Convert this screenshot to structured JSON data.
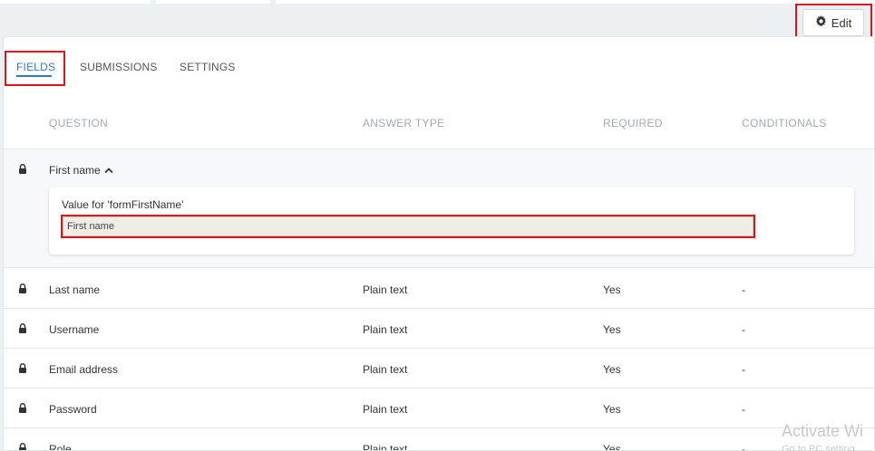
{
  "toolbar": {
    "edit_label": "Edit"
  },
  "tabs": [
    {
      "label": "FIELDS",
      "active": true
    },
    {
      "label": "SUBMISSIONS",
      "active": false
    },
    {
      "label": "SETTINGS",
      "active": false
    }
  ],
  "table": {
    "headers": {
      "question": "QUESTION",
      "answer_type": "ANSWER TYPE",
      "required": "REQUIRED",
      "conditionals": "CONDITIONALS"
    },
    "expanded": {
      "question": "First name",
      "value_label": "Value for 'formFirstName'",
      "value": "First name"
    },
    "rows": [
      {
        "question": "Last name",
        "answer_type": "Plain text",
        "required": "Yes",
        "conditionals": "-"
      },
      {
        "question": "Username",
        "answer_type": "Plain text",
        "required": "Yes",
        "conditionals": "-"
      },
      {
        "question": "Email address",
        "answer_type": "Plain text",
        "required": "Yes",
        "conditionals": "-"
      },
      {
        "question": "Password",
        "answer_type": "Plain text",
        "required": "Yes",
        "conditionals": "-"
      },
      {
        "question": "Role",
        "answer_type": "Plain text",
        "required": "Yes",
        "conditionals": "-"
      }
    ]
  },
  "watermark": {
    "title": "Activate Wi",
    "subtitle": "Go to PC setting"
  },
  "colors": {
    "accent": "#3178c6",
    "highlight": "#d9141b",
    "input_bg": "#eeede6"
  },
  "icons": {
    "edit": "gear-icon",
    "row": "lock-icon",
    "expand": "chevron-up-icon"
  }
}
